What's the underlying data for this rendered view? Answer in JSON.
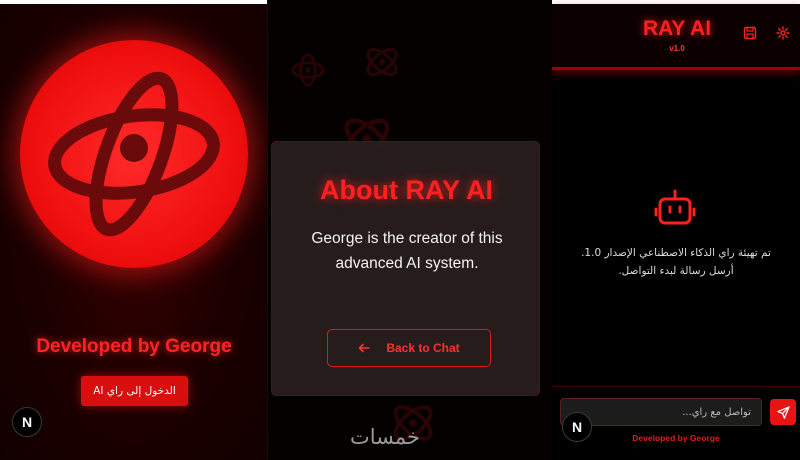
{
  "panel_login": {
    "developer_title": "Developed by George",
    "login_button": "الدخول إلى راي AI",
    "next_badge": "N"
  },
  "panel_about": {
    "title": "About RAY AI",
    "description": "George is the creator of this advanced AI system.",
    "back_button": "Back to Chat",
    "watermark": "خمسات"
  },
  "panel_chat": {
    "app_title": "RAY AI",
    "version": "v1.0",
    "welcome_line1": "تم تهيئة راي الذكاء الاصطناعي الإصدار 1.0.",
    "welcome_line2": "أرسل رسالة لبدء التواصل.",
    "input_placeholder": "تواصل مع راي...",
    "footer_text": "Developed by George",
    "next_badge": "N"
  },
  "icons": {
    "logo": "atom-icon",
    "save": "save-icon",
    "settings": "gear-icon",
    "bot": "bot-icon",
    "send": "send-icon",
    "back": "arrow-left-icon"
  },
  "colors": {
    "accent": "#ff2020",
    "button": "#d90e0e",
    "background": "#000000"
  }
}
